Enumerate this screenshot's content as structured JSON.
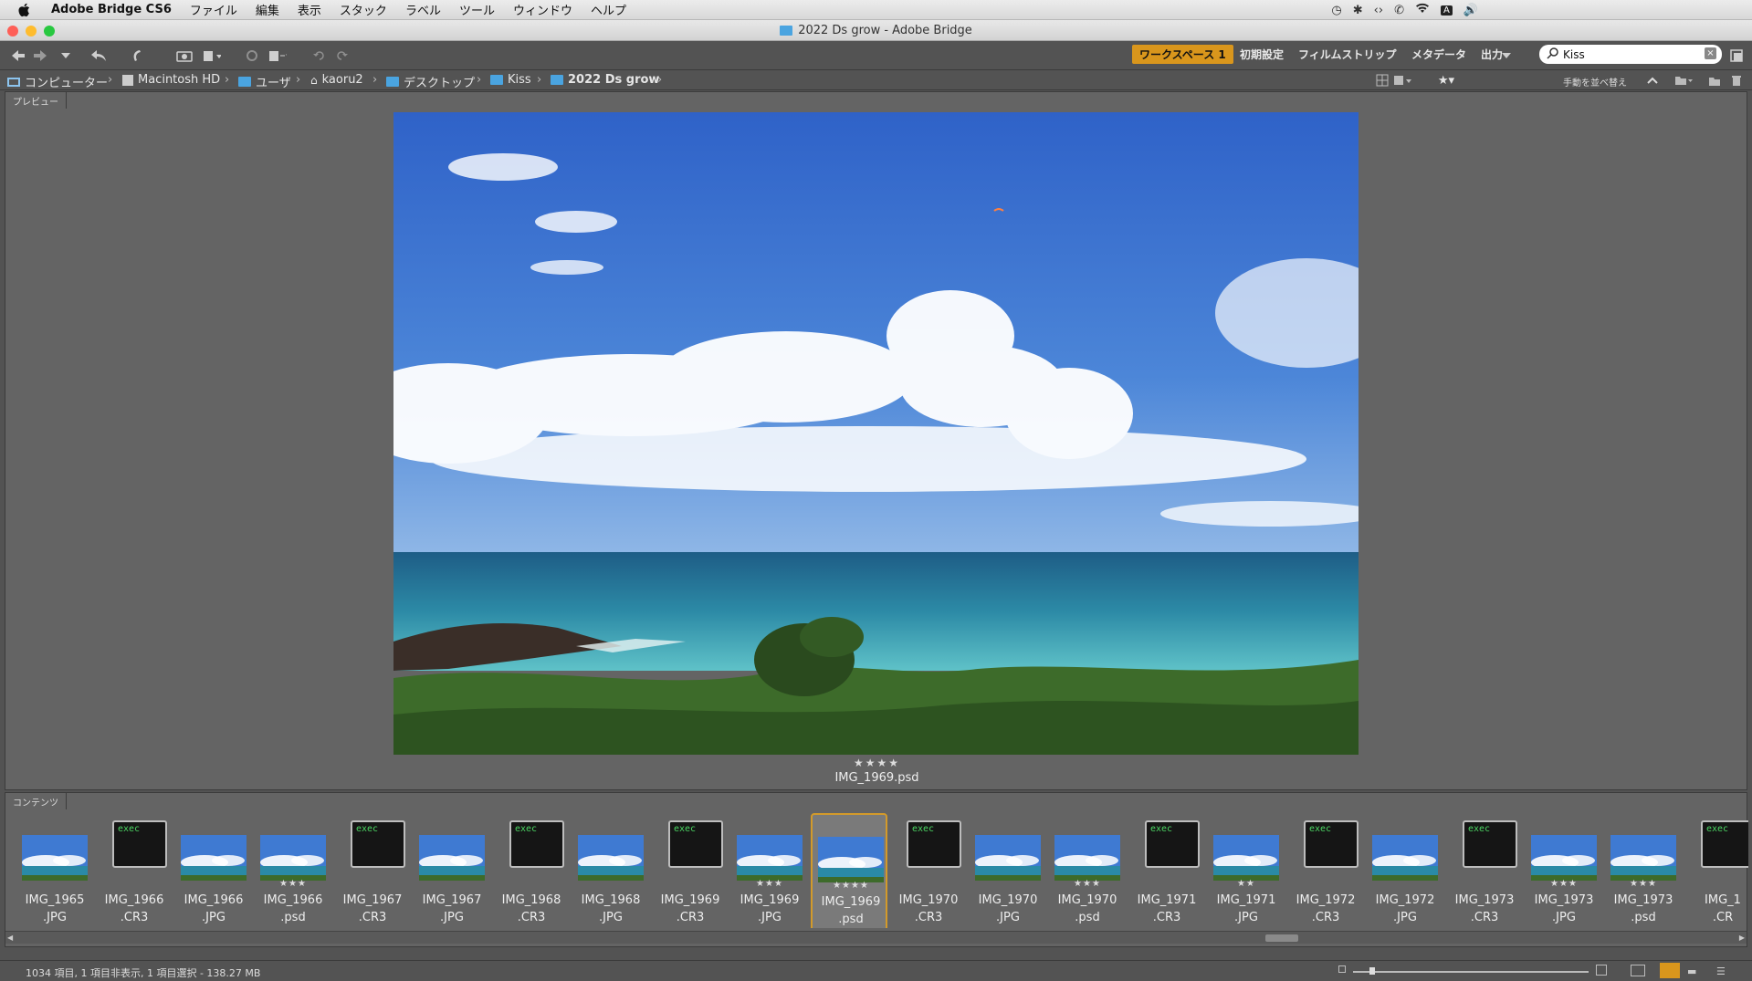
{
  "menubar": {
    "app_name": "Adobe Bridge CS6",
    "items": [
      "ファイル",
      "編集",
      "表示",
      "スタック",
      "ラベル",
      "ツール",
      "ウィンドウ",
      "ヘルプ"
    ]
  },
  "window": {
    "title": "2022 Ds grow - Adobe Bridge"
  },
  "toolbar": {
    "workspaces": [
      "ワークスペース 1",
      "初期設定",
      "フィルムストリップ",
      "メタデータ",
      "出力"
    ],
    "search_value": "Kiss"
  },
  "pathbar": {
    "crumbs": [
      "コンピューター",
      "Macintosh HD",
      "ユーザ",
      "kaoru2",
      "デスクトップ",
      "Kiss",
      "2022 Ds grow"
    ],
    "sort_label": "手動を並べ替え"
  },
  "preview": {
    "tab_label": "プレビュー",
    "stars": "★★★★",
    "filename": "IMG_1969.psd"
  },
  "content": {
    "tab_label": "コンテンツ",
    "thumbs": [
      {
        "line1": "IMG_1965",
        "line2": ".JPG",
        "type": "image",
        "stars": ""
      },
      {
        "line1": "IMG_1966",
        "line2": ".CR3",
        "type": "exec",
        "stars": ""
      },
      {
        "line1": "IMG_1966",
        "line2": ".JPG",
        "type": "image",
        "stars": ""
      },
      {
        "line1": "IMG_1966",
        "line2": ".psd",
        "type": "image",
        "stars": "★★★"
      },
      {
        "line1": "IMG_1967",
        "line2": ".CR3",
        "type": "exec",
        "stars": ""
      },
      {
        "line1": "IMG_1967",
        "line2": ".JPG",
        "type": "image",
        "stars": ""
      },
      {
        "line1": "IMG_1968",
        "line2": ".CR3",
        "type": "exec",
        "stars": ""
      },
      {
        "line1": "IMG_1968",
        "line2": ".JPG",
        "type": "image",
        "stars": ""
      },
      {
        "line1": "IMG_1969",
        "line2": ".CR3",
        "type": "exec",
        "stars": ""
      },
      {
        "line1": "IMG_1969",
        "line2": ".JPG",
        "type": "image",
        "stars": "★★★"
      },
      {
        "line1": "IMG_1969",
        "line2": ".psd",
        "type": "image",
        "stars": "★★★★",
        "selected": true
      },
      {
        "line1": "IMG_1970",
        "line2": ".CR3",
        "type": "exec",
        "stars": ""
      },
      {
        "line1": "IMG_1970",
        "line2": ".JPG",
        "type": "image",
        "stars": ""
      },
      {
        "line1": "IMG_1970",
        "line2": ".psd",
        "type": "image",
        "stars": "★★★"
      },
      {
        "line1": "IMG_1971",
        "line2": ".CR3",
        "type": "exec",
        "stars": ""
      },
      {
        "line1": "IMG_1971",
        "line2": ".JPG",
        "type": "image",
        "stars": "★★"
      },
      {
        "line1": "IMG_1972",
        "line2": ".CR3",
        "type": "exec",
        "stars": ""
      },
      {
        "line1": "IMG_1972",
        "line2": ".JPG",
        "type": "image",
        "stars": ""
      },
      {
        "line1": "IMG_1973",
        "line2": ".CR3",
        "type": "exec",
        "stars": ""
      },
      {
        "line1": "IMG_1973",
        "line2": ".JPG",
        "type": "image",
        "stars": "★★★"
      },
      {
        "line1": "IMG_1973",
        "line2": ".psd",
        "type": "image",
        "stars": "★★★"
      },
      {
        "line1": "IMG_1",
        "line2": ".CR",
        "type": "exec",
        "stars": ""
      }
    ],
    "exec_text": "exec"
  },
  "status": {
    "text": "1034 項目, 1 項目非表示, 1 項目選択 - 138.27 MB"
  },
  "colors": {
    "accent": "#d9961c",
    "panel": "#646464",
    "bg": "#535353"
  }
}
